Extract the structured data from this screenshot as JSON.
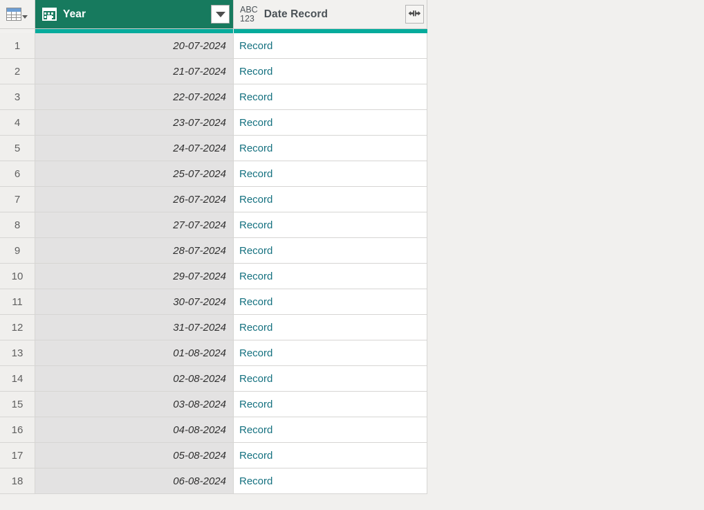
{
  "grid": {
    "corner": {
      "icon": "table-icon",
      "dropdown_icon": "chevron-down-icon"
    },
    "columns": [
      {
        "name": "Year",
        "type_icon": "date-type-icon",
        "type_icon_label": "",
        "selected": true,
        "filter_icon": "filter-dropdown-icon",
        "align": "right",
        "italic": true
      },
      {
        "name": "Date Record",
        "type_icon": "any-type-icon",
        "type_icon_label_top": "ABC",
        "type_icon_label_bottom": "123",
        "selected": false,
        "expand_icon": "expand-columns-icon",
        "align": "left",
        "italic": false
      }
    ],
    "rows": [
      {
        "num": "1",
        "year": "20-07-2024",
        "record": "Record"
      },
      {
        "num": "2",
        "year": "21-07-2024",
        "record": "Record"
      },
      {
        "num": "3",
        "year": "22-07-2024",
        "record": "Record"
      },
      {
        "num": "4",
        "year": "23-07-2024",
        "record": "Record"
      },
      {
        "num": "5",
        "year": "24-07-2024",
        "record": "Record"
      },
      {
        "num": "6",
        "year": "25-07-2024",
        "record": "Record"
      },
      {
        "num": "7",
        "year": "26-07-2024",
        "record": "Record"
      },
      {
        "num": "8",
        "year": "27-07-2024",
        "record": "Record"
      },
      {
        "num": "9",
        "year": "28-07-2024",
        "record": "Record"
      },
      {
        "num": "10",
        "year": "29-07-2024",
        "record": "Record"
      },
      {
        "num": "11",
        "year": "30-07-2024",
        "record": "Record"
      },
      {
        "num": "12",
        "year": "31-07-2024",
        "record": "Record"
      },
      {
        "num": "13",
        "year": "01-08-2024",
        "record": "Record"
      },
      {
        "num": "14",
        "year": "02-08-2024",
        "record": "Record"
      },
      {
        "num": "15",
        "year": "03-08-2024",
        "record": "Record"
      },
      {
        "num": "16",
        "year": "04-08-2024",
        "record": "Record"
      },
      {
        "num": "17",
        "year": "05-08-2024",
        "record": "Record"
      },
      {
        "num": "18",
        "year": "06-08-2024",
        "record": "Record"
      }
    ]
  },
  "colors": {
    "header_selected_bg": "#177a5e",
    "header_unselected_bg": "#f2f1ef",
    "accent_bar": "#05ab9c",
    "record_link": "#14707f",
    "selected_column_bg": "#e3e2e2",
    "row_number_bg": "#f0efed",
    "page_bg": "#f1f0ee"
  }
}
